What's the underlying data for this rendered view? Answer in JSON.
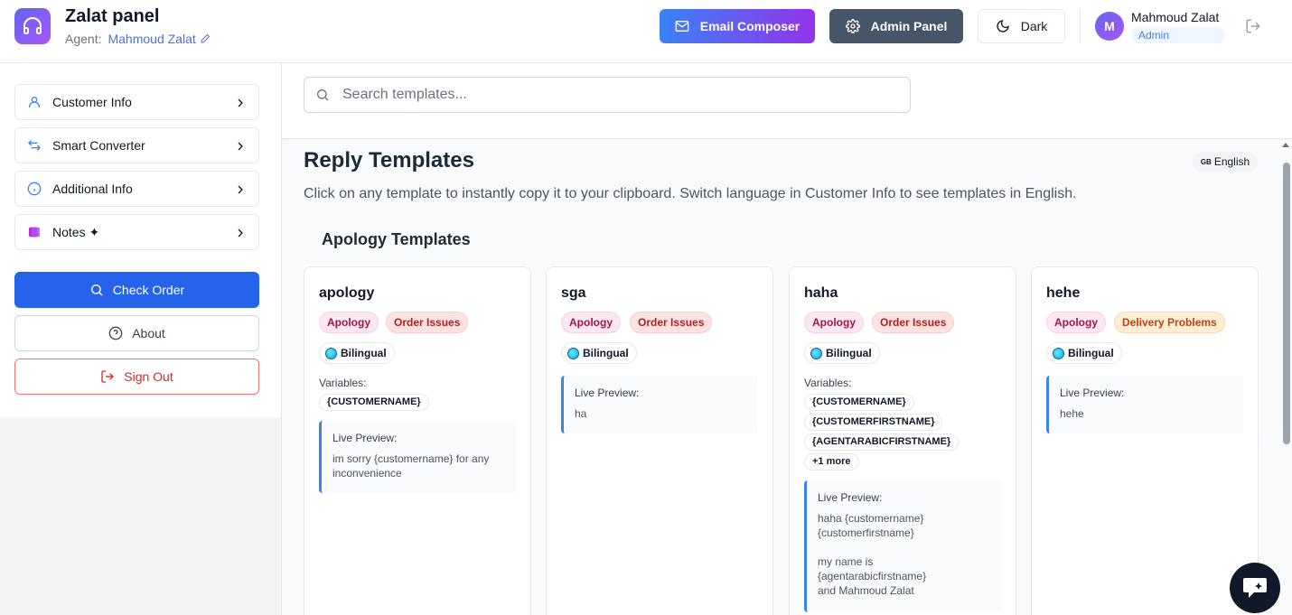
{
  "header": {
    "app_title": "Zalat panel",
    "agent_label": "Agent:",
    "agent_name": "Mahmoud Zalat",
    "email_composer": "Email Composer",
    "admin_panel": "Admin Panel",
    "theme": "Dark",
    "user_initial": "M",
    "user_name": "Mahmoud Zalat",
    "user_role": "Admin"
  },
  "sidebar": {
    "items": [
      {
        "label": "Customer Info",
        "icon": "user-icon"
      },
      {
        "label": "Smart Converter",
        "icon": "arrows-icon"
      },
      {
        "label": "Additional Info",
        "icon": "info-icon"
      },
      {
        "label": "Notes ✦",
        "icon": "notes-icon"
      }
    ],
    "check_order": "Check Order",
    "about": "About",
    "sign_out": "Sign Out"
  },
  "search": {
    "placeholder": "Search templates..."
  },
  "main": {
    "title": "Reply Templates",
    "language_flag": "GB",
    "language": "English",
    "description": "Click on any template to instantly copy it to your clipboard. Switch language in Customer Info to see templates in English.",
    "section_title": "Apology Templates"
  },
  "templates": [
    {
      "title": "apology",
      "tags": [
        "Apology",
        "Order Issues"
      ],
      "bilingual": "Bilingual",
      "variables_label": "Variables:",
      "variables": [
        "{CUSTOMERNAME}"
      ],
      "preview_label": "Live Preview:",
      "preview_text": "im sorry {customername} for any inconvenience"
    },
    {
      "title": "sga",
      "tags": [
        "Apology",
        "Order Issues"
      ],
      "bilingual": "Bilingual",
      "preview_label": "Live Preview:",
      "preview_text": "ha"
    },
    {
      "title": "haha",
      "tags": [
        "Apology",
        "Order Issues"
      ],
      "bilingual": "Bilingual",
      "variables_label": "Variables:",
      "variables": [
        "{CUSTOMERNAME}",
        "{CUSTOMERFIRSTNAME}",
        "{AGENTARABICFIRSTNAME}",
        "+1 more"
      ],
      "preview_label": "Live Preview:",
      "preview_text": "haha {customername}\n{customerfirstname}\n\nmy name is\n{agentarabicfirstname}\nand Mahmoud Zalat"
    },
    {
      "title": "hehe",
      "tags": [
        "Apology",
        "Delivery Problems"
      ],
      "bilingual": "Bilingual",
      "preview_label": "Live Preview:",
      "preview_text": "hehe"
    }
  ],
  "colors": {
    "primary": "#2563eb",
    "accent_gradient_start": "#3b82f6",
    "accent_gradient_end": "#9333ea",
    "danger": "#dc2626"
  }
}
